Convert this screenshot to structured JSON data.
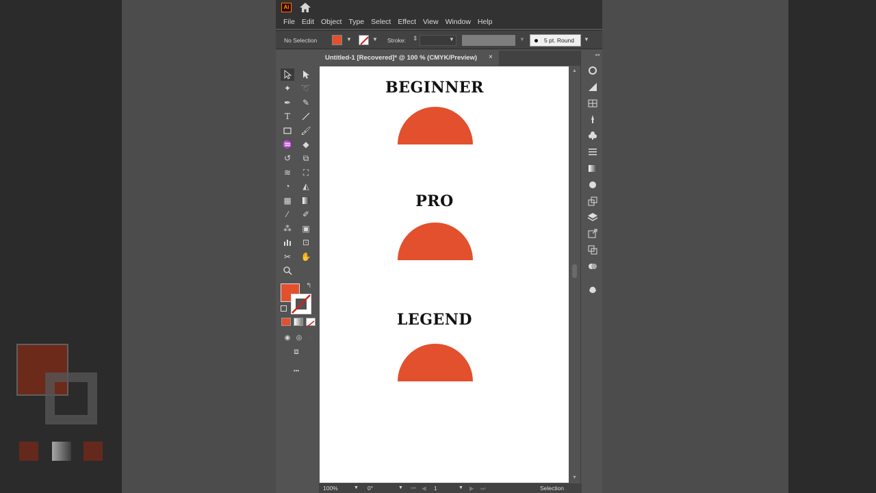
{
  "app": {
    "logo": "Ai",
    "menu": [
      "File",
      "Edit",
      "Object",
      "Type",
      "Select",
      "Effect",
      "View",
      "Window",
      "Help"
    ]
  },
  "control_bar": {
    "selection_label": "No Selection",
    "stroke_label": "Stroke:",
    "brush_label": "5 pt. Round",
    "fill_color": "#e2502d"
  },
  "document": {
    "tab_title": "Untitled-1 [Recovered]* @ 100 % (CMYK/Preview)",
    "close_glyph": "×"
  },
  "artboard": {
    "headings": [
      "BEGINNER",
      "PRO",
      "LEGEND"
    ],
    "shape_color": "#e2502d"
  },
  "toolbar": {
    "fill_color": "#e2502d",
    "more_glyph": "•••"
  },
  "status": {
    "zoom": "100%",
    "rotation": "0°",
    "artboard_number": "1",
    "tool_name": "Selection"
  }
}
